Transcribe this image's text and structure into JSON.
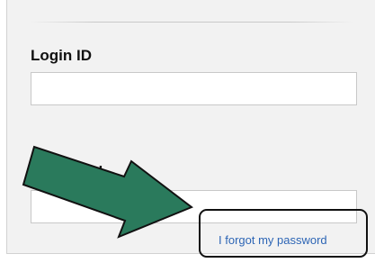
{
  "login_form": {
    "login_id_label": "Login ID",
    "login_id_value": "",
    "password_label": "Password",
    "password_value": "",
    "forgot_password_link": "I forgot my password"
  },
  "annotation": {
    "arrow_color": "#2a7a5c",
    "arrow_outline": "#111111",
    "highlight_border_color": "#111111"
  }
}
